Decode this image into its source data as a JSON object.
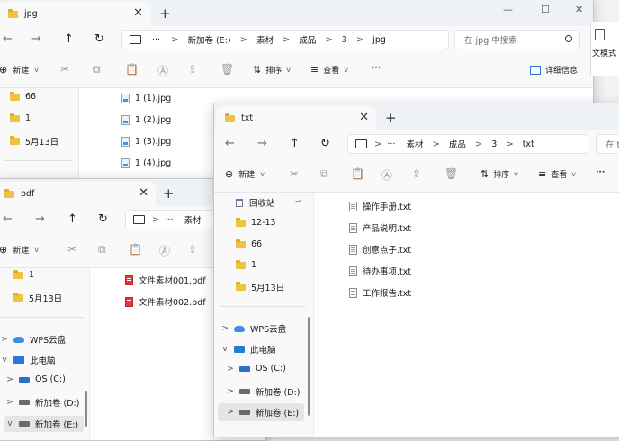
{
  "windows": {
    "jpg": {
      "tab_title": "jpg",
      "breadcrumb": [
        "新加卷 (E:)",
        "素材",
        "成品",
        "3",
        "jpg"
      ],
      "search_placeholder": "在 jpg 中搜索",
      "toolbar": {
        "new_label": "新建",
        "sort_label": "排序",
        "view_label": "查看",
        "more_label": "···",
        "details_label": "详细信息"
      },
      "right_edge_text": "文模式",
      "nav_items": [
        "66",
        "1",
        "5月13日"
      ],
      "files": [
        "1 (1).jpg",
        "1 (2).jpg",
        "1 (3).jpg",
        "1 (4).jpg"
      ]
    },
    "pdf": {
      "tab_title": "pdf",
      "breadcrumb": [
        "素材"
      ],
      "toolbar": {
        "new_label": "新建"
      },
      "nav_items": [
        "1",
        "5月13日"
      ],
      "nav_tree": [
        {
          "label": "WPS云盘",
          "chevron": ">"
        },
        {
          "label": "此电脑",
          "chevron": "v"
        },
        {
          "label": "OS (C:)",
          "chevron": ">"
        },
        {
          "label": "新加卷 (D:)",
          "chevron": ">"
        },
        {
          "label": "新加卷 (E:)",
          "chevron": "v"
        }
      ],
      "files": [
        "文件素材001.pdf",
        "文件素材002.pdf"
      ]
    },
    "txt": {
      "tab_title": "txt",
      "breadcrumb": [
        "素材",
        "成品",
        "3",
        "txt"
      ],
      "search_placeholder": "在 t",
      "toolbar": {
        "new_label": "新建",
        "sort_label": "排序",
        "view_label": "查看",
        "more_label": "···"
      },
      "nav_items": [
        "回收站",
        "12-13",
        "66",
        "1",
        "5月13日"
      ],
      "nav_tree": [
        {
          "label": "WPS云盘",
          "chevron": ">"
        },
        {
          "label": "此电脑",
          "chevron": "v"
        },
        {
          "label": "OS (C:)",
          "chevron": ">"
        },
        {
          "label": "新加卷 (D:)",
          "chevron": ">"
        },
        {
          "label": "新加卷 (E:)",
          "chevron": ">"
        }
      ],
      "files": [
        "操作手册.txt",
        "产品说明.txt",
        "创意点子.txt",
        "待办事项.txt",
        "工作报告.txt"
      ]
    }
  },
  "glyphs": {
    "back": "←",
    "forward": "→",
    "up": "↑",
    "refresh": "↻",
    "close": "✕",
    "plus": "+",
    "minimize": "—",
    "maximize": "☐",
    "chevron_right": ">",
    "chevron_down": "v",
    "sort_icon": "⇅",
    "view_icon": "≡",
    "new_icon": "⊕",
    "pin": "📌"
  }
}
